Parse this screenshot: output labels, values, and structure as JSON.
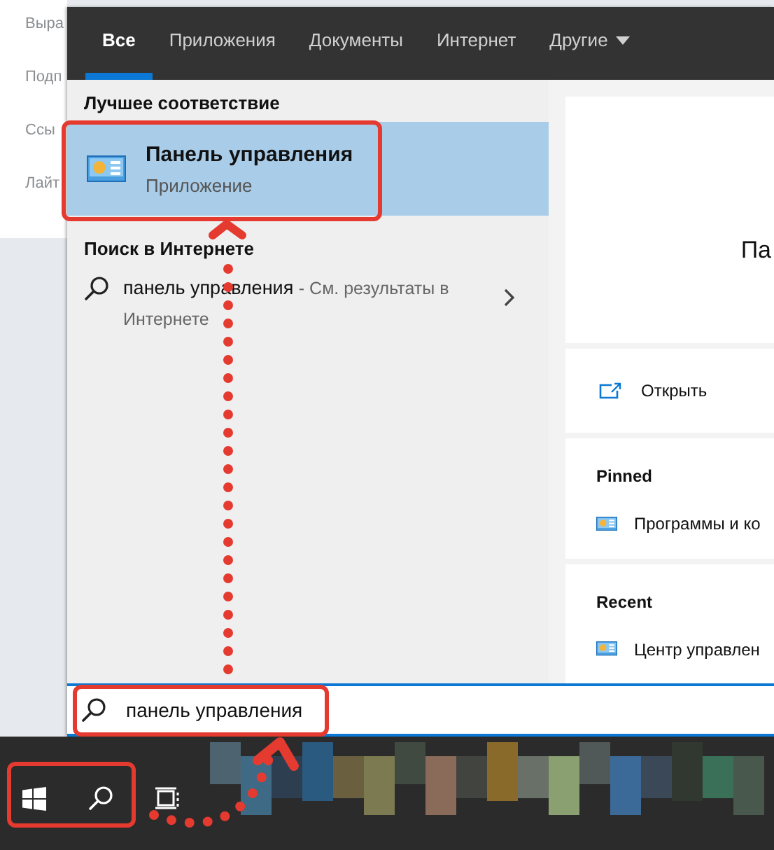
{
  "background_page": {
    "lines": [
      "Выра",
      "Подп",
      "Ссы",
      "Лайт"
    ]
  },
  "tabs": [
    {
      "label": "Все",
      "selected": true,
      "kind": "plain"
    },
    {
      "label": "Приложения",
      "selected": false,
      "kind": "plain"
    },
    {
      "label": "Документы",
      "selected": false,
      "kind": "plain"
    },
    {
      "label": "Интернет",
      "selected": false,
      "kind": "plain"
    },
    {
      "label": "Другие",
      "selected": false,
      "kind": "menu"
    }
  ],
  "best_match": {
    "heading": "Лучшее соответствие",
    "title": "Панель управления",
    "subtitle": "Приложение",
    "selected": true
  },
  "web_search": {
    "heading": "Поиск в Интернете",
    "query": "панель управления",
    "hint": "- См. результаты в Интернете"
  },
  "details": {
    "title": "Па",
    "actions": [
      {
        "label": "Открыть"
      }
    ],
    "sections": [
      {
        "heading": "Pinned",
        "items": [
          "Программы и ко"
        ]
      },
      {
        "heading": "Recent",
        "items": [
          "Центр управлен"
        ]
      }
    ]
  },
  "search": {
    "value": "панель управления"
  },
  "taskbar": {
    "buttons": [
      {
        "kind": "start"
      },
      {
        "kind": "search"
      },
      {
        "kind": "task-view"
      }
    ]
  }
}
